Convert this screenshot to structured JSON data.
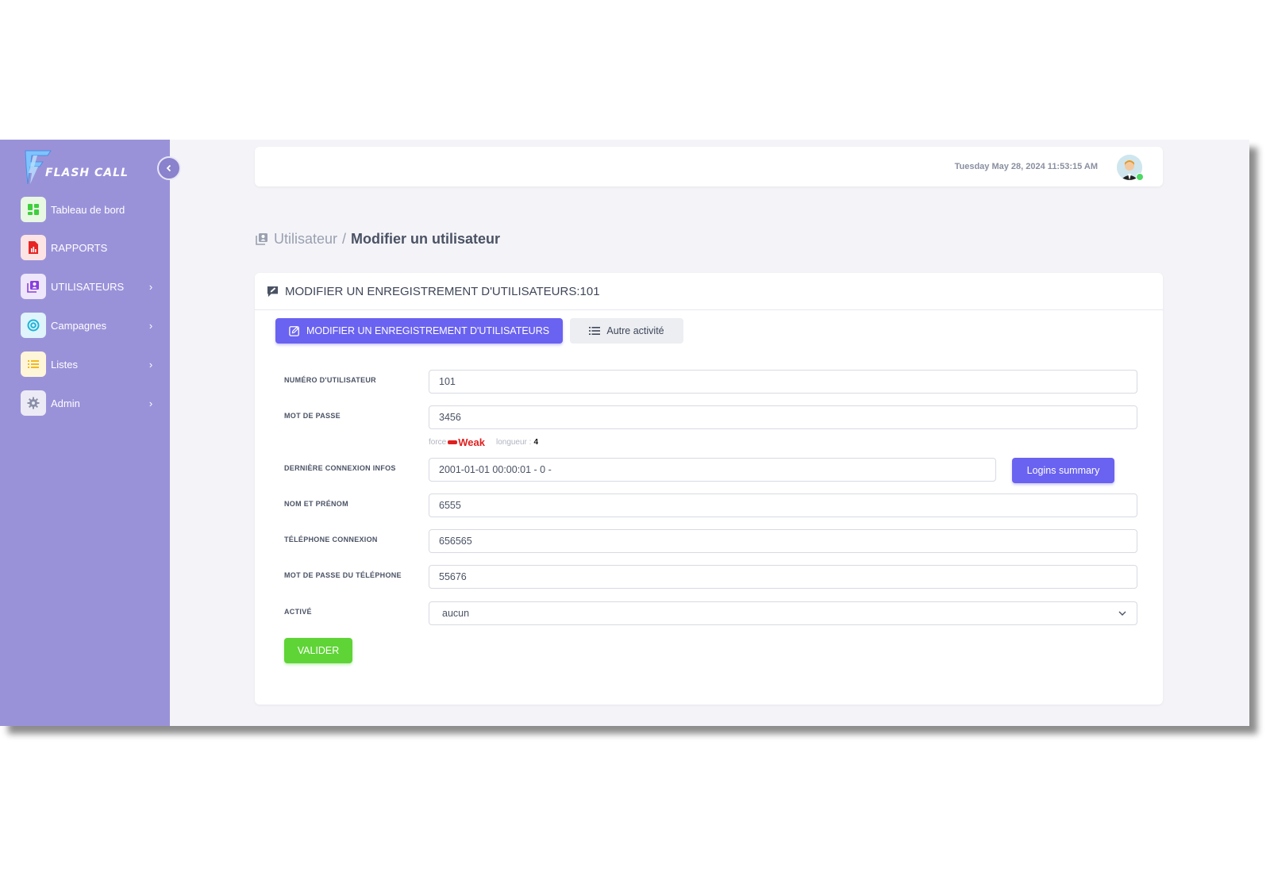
{
  "app": {
    "brand": "FLASH CALL"
  },
  "sidebar": {
    "items": [
      {
        "label": "Tableau de bord",
        "icon": "dashboard-icon"
      },
      {
        "label": "RAPPORTS",
        "icon": "report-icon"
      },
      {
        "label": "UTILISATEURS",
        "icon": "users-icon"
      },
      {
        "label": "Campagnes",
        "icon": "target-icon"
      },
      {
        "label": "Listes",
        "icon": "list-icon"
      },
      {
        "label": "Admin",
        "icon": "gear-icon"
      }
    ]
  },
  "topbar": {
    "datetime": "Tuesday May 28, 2024 11:53:15 AM"
  },
  "breadcrumb": {
    "parent": "Utilisateur",
    "separator": "/",
    "current": "Modifier un utilisateur"
  },
  "card": {
    "title": "MODIFIER UN ENREGISTREMENT D'UTILISATEURS:101",
    "tabs": {
      "primary": "MODIFIER UN ENREGISTREMENT D'UTILISATEURS",
      "secondary": "Autre activité"
    }
  },
  "form": {
    "user_number": {
      "label": "NUMÉRO D'UTILISATEUR",
      "value": "101"
    },
    "password": {
      "label": "MOT DE PASSE",
      "value": "3456"
    },
    "password_meta": {
      "force_label": "force",
      "strength": "Weak",
      "length_label": "longueur :",
      "length": "4"
    },
    "last_login": {
      "label": "DERNIÈRE CONNEXION INFOS",
      "value": "2001-01-01 00:00:01 - 0 -"
    },
    "logins_button": "Logins summary",
    "full_name": {
      "label": "NOM ET PRÉNOM",
      "value": "6555"
    },
    "phone_login": {
      "label": "TÉLÉPHONE CONNEXION",
      "value": "656565"
    },
    "phone_password": {
      "label": "MOT DE PASSE DU TÉLÉPHONE",
      "value": "55676"
    },
    "active": {
      "label": "ACTIVÉ",
      "value": "aucun"
    },
    "submit": "VALIDER"
  },
  "colors": {
    "sidebar": "#9a92d9",
    "accent": "#6a62f0",
    "success": "#5fd436",
    "danger": "#e02020"
  }
}
